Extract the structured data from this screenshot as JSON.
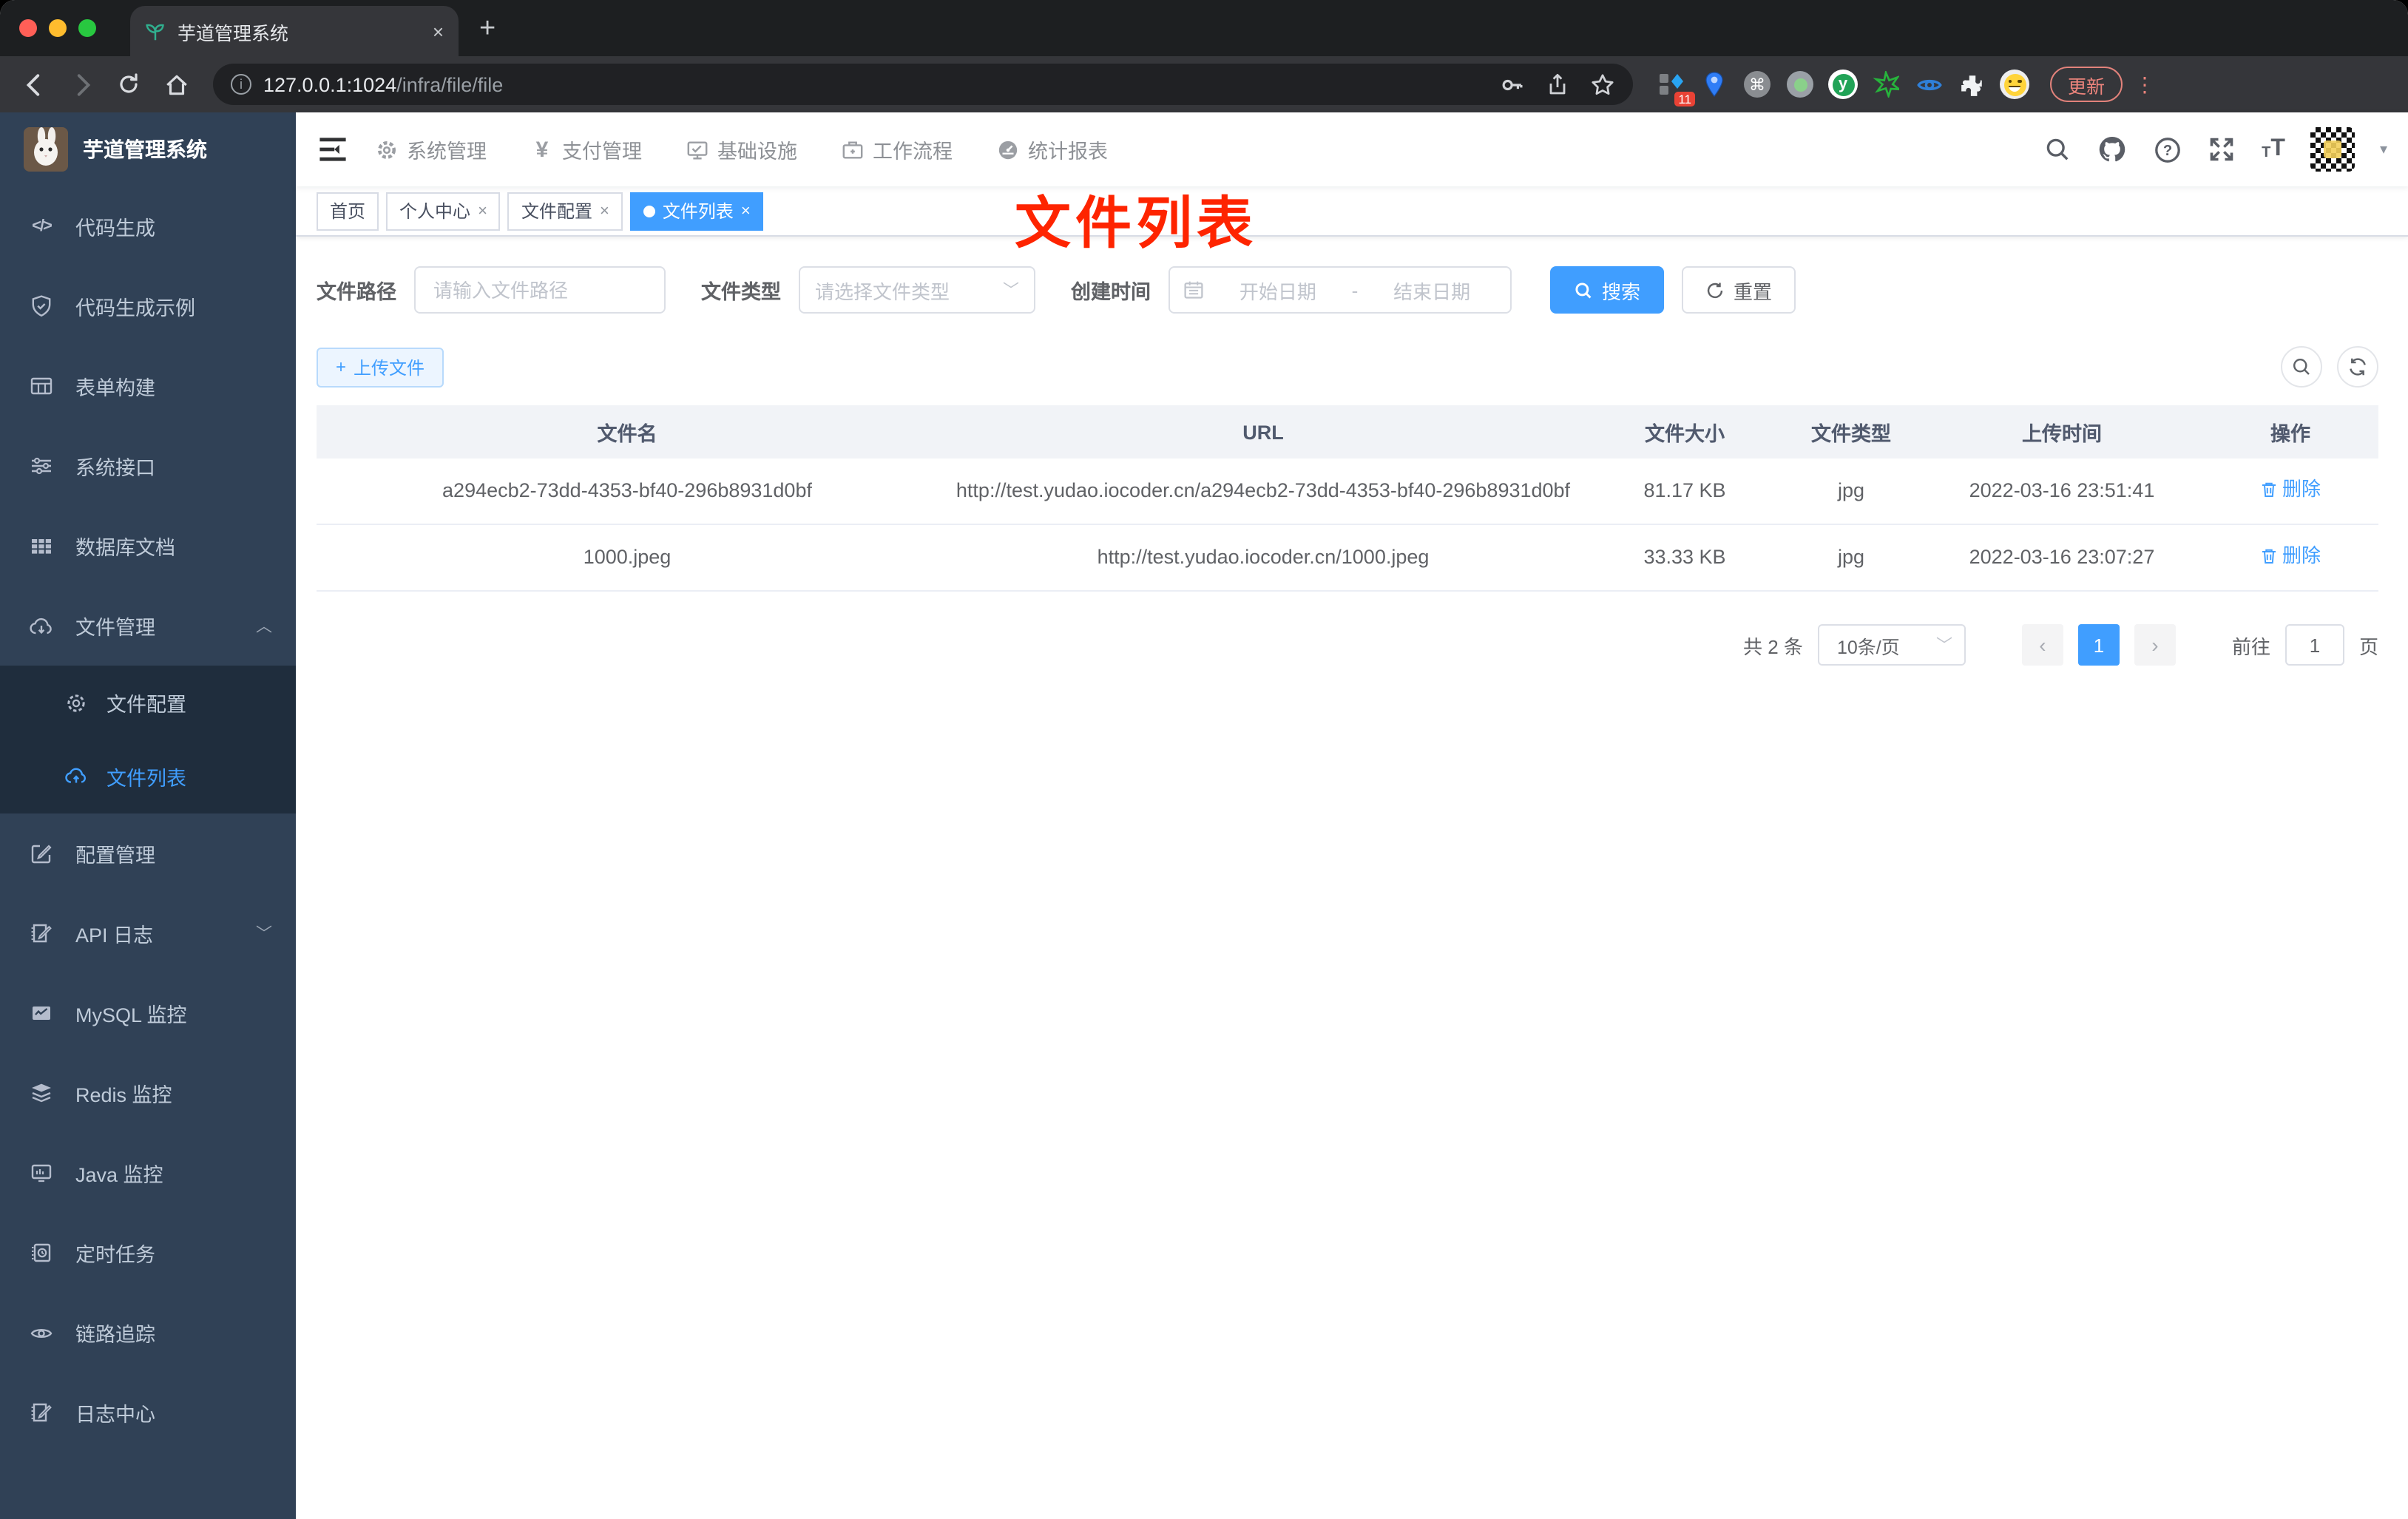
{
  "browser": {
    "tab_title": "芋道管理系统",
    "tab_close": "×",
    "new_tab": "+",
    "url_host": "127.0.0.1:1024",
    "url_path": "/infra/file/file",
    "update_label": "更新",
    "ext_badge": "11",
    "kebab": "⋮"
  },
  "sidebar": {
    "title": "芋道管理系统",
    "items": [
      {
        "label": "代码生成",
        "glyph": "</>"
      },
      {
        "label": "代码生成示例"
      },
      {
        "label": "表单构建"
      },
      {
        "label": "系统接口"
      },
      {
        "label": "数据库文档"
      },
      {
        "label": "文件管理"
      },
      {
        "label": "文件配置"
      },
      {
        "label": "文件列表"
      },
      {
        "label": "配置管理"
      },
      {
        "label": "API 日志"
      },
      {
        "label": "MySQL 监控"
      },
      {
        "label": "Redis 监控"
      },
      {
        "label": "Java 监控"
      },
      {
        "label": "定时任务"
      },
      {
        "label": "链路追踪"
      },
      {
        "label": "日志中心"
      }
    ]
  },
  "topnav": {
    "menus": [
      {
        "label": "系统管理"
      },
      {
        "label": "支付管理",
        "glyph": "¥"
      },
      {
        "label": "基础设施"
      },
      {
        "label": "工作流程"
      },
      {
        "label": "统计报表"
      }
    ]
  },
  "tabs": {
    "close_glyph": "×",
    "items": [
      {
        "label": "首页"
      },
      {
        "label": "个人中心"
      },
      {
        "label": "文件配置"
      },
      {
        "label": "文件列表"
      }
    ]
  },
  "annotation": "文件列表",
  "filters": {
    "path_label": "文件路径",
    "path_placeholder": "请输入文件路径",
    "type_label": "文件类型",
    "type_placeholder": "请选择文件类型",
    "date_label": "创建时间",
    "date_start": "开始日期",
    "date_sep": "-",
    "date_end": "结束日期",
    "search": "搜索",
    "reset": "重置"
  },
  "actions": {
    "upload": "上传文件",
    "upload_plus": "+"
  },
  "table": {
    "headers": [
      "文件名",
      "URL",
      "文件大小",
      "文件类型",
      "上传时间",
      "操作"
    ],
    "rows": [
      {
        "name": "a294ecb2-73dd-4353-bf40-296b8931d0bf",
        "url": "http://test.yudao.iocoder.cn/a294ecb2-73dd-4353-bf40-296b8931d0bf",
        "size": "81.17 KB",
        "type": "jpg",
        "time": "2022-03-16 23:51:41",
        "action": "删除"
      },
      {
        "name": "1000.jpeg",
        "url": "http://test.yudao.iocoder.cn/1000.jpeg",
        "size": "33.33 KB",
        "type": "jpg",
        "time": "2022-03-16 23:07:27",
        "action": "删除"
      }
    ]
  },
  "pagination": {
    "total": "共 2 条",
    "page_size": "10条/页",
    "page": "1",
    "prev": "‹",
    "next": "›",
    "goto_label": "前往",
    "goto_value": "1",
    "unit": "页"
  },
  "ui": {
    "font_icon": "T",
    "caret": "▾",
    "cmd": "⌘"
  },
  "colors": {
    "accent": "#409eff",
    "annotation": "#fe2400",
    "sidebar_bg": "#304156",
    "submenu_bg": "#1f2d3d"
  }
}
